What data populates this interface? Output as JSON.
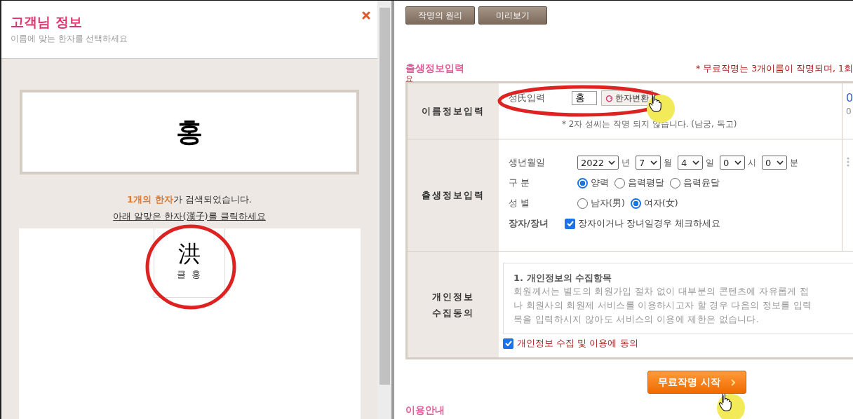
{
  "popup": {
    "title": "고객님 정보",
    "subtitle": "이름에 맞는 한자를 선택하세요",
    "surname": "홍",
    "result_text": "**1개의 한자**가 검색되었습니다.",
    "instruction": "아래 알맞은 한자(漢子)를 클릭하세요",
    "hanja": [
      {
        "char": "洪",
        "reading": "클 홍"
      }
    ]
  },
  "toolbar_buttons": [
    "작명의 원리",
    "미리보기"
  ],
  "section_title": "출생정보입력",
  "notice": "* 무료작명는 3개이름이 작명되며, 1회",
  "notice_wrap": "요",
  "name_row": {
    "label": "이름정보입력",
    "field_label": "성氏입력",
    "surname_value": "홍",
    "convert_button": "한자변환",
    "hint": "* 2자 성씨는 작명 되지 않습니다. (남궁, 독고)"
  },
  "side_partial": [
    "0",
    "0"
  ],
  "birth_row": {
    "label": "출생정보입력",
    "birthdate": {
      "label": "생년월일",
      "parts": [
        {
          "value": "2022",
          "unit": "년"
        },
        {
          "value": "7",
          "unit": "월"
        },
        {
          "value": "4",
          "unit": "일"
        },
        {
          "value": "0",
          "unit": "시"
        },
        {
          "value": "0",
          "unit": "분"
        }
      ]
    },
    "calendar": {
      "label": "구 분",
      "options": [
        {
          "label": "양력",
          "selected": true
        },
        {
          "label": "음력평달",
          "selected": false
        },
        {
          "label": "음력윤달",
          "selected": false
        }
      ]
    },
    "gender": {
      "label": "성 별",
      "options": [
        {
          "label": "남자(男)",
          "selected": false
        },
        {
          "label": "여자(女)",
          "selected": true
        }
      ]
    },
    "eldest": {
      "label": "장자/장녀",
      "checked": true,
      "text": "장자이거나 장녀일경우 체크하세요"
    }
  },
  "consent_row": {
    "label_lines": [
      "개인정보",
      "수집동의"
    ],
    "heading": "1. 개인정보의 수집항목",
    "body_lines": [
      "회원께서는 별도의 회원가입 절차 없이 대부분의 콘텐츠에 자유롭게 접",
      "나 회원사의 회원제 서비스를 이용하시고자 할 경우 다음의 정보를 입력",
      "목을 입력하시지 않아도 서비스의 이용에 제한은 없습니다."
    ],
    "agree": {
      "checked": true,
      "text": "개인정보 수집 및 이용에 동의"
    }
  },
  "start_button": "무료작명 시작",
  "footer_heading": "이용안내"
}
